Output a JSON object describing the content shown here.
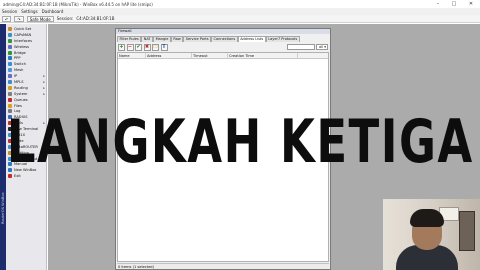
{
  "titlebar": {
    "title": "admin@C4:AD:34:B1:0F:1B (MikroTik) - WinBox v6.44.5 on hAP lite (smips)"
  },
  "menubar": {
    "items": [
      "Session",
      "Settings",
      "Dashboard"
    ]
  },
  "toolbar": {
    "safe_mode_label": "Safe Mode",
    "session_label": "Session:",
    "session_value": "C4:AD:34:B1:0F:1B"
  },
  "sidebar": {
    "vertical_label": "RouterOS WinBox",
    "items": [
      {
        "label": "Quick Set",
        "icon": "quickset-icon",
        "color": "#d08a2a",
        "submenu": false
      },
      {
        "label": "CAPsMAN",
        "icon": "capsman-icon",
        "color": "#3a8fd0",
        "submenu": false
      },
      {
        "label": "Interfaces",
        "icon": "interfaces-icon",
        "color": "#2a9a3a",
        "submenu": false
      },
      {
        "label": "Wireless",
        "icon": "wireless-icon",
        "color": "#6a6ac8",
        "submenu": false
      },
      {
        "label": "Bridge",
        "icon": "bridge-icon",
        "color": "#2a9a3a",
        "submenu": false
      },
      {
        "label": "PPP",
        "icon": "ppp-icon",
        "color": "#2a7ac0",
        "submenu": false
      },
      {
        "label": "Switch",
        "icon": "switch-icon",
        "color": "#3a8fd0",
        "submenu": false
      },
      {
        "label": "Mesh",
        "icon": "mesh-icon",
        "color": "#4a9ad8",
        "submenu": false
      },
      {
        "label": "IP",
        "icon": "ip-icon",
        "color": "#6a6ac8",
        "submenu": true
      },
      {
        "label": "MPLS",
        "icon": "mpls-icon",
        "color": "#3a8fd0",
        "submenu": true
      },
      {
        "label": "Routing",
        "icon": "routing-icon",
        "color": "#d0a02a",
        "submenu": true
      },
      {
        "label": "System",
        "icon": "system-icon",
        "color": "#808080",
        "submenu": true
      },
      {
        "label": "Queues",
        "icon": "queues-icon",
        "color": "#c0302a",
        "submenu": false
      },
      {
        "label": "Files",
        "icon": "files-icon",
        "color": "#d0a02a",
        "submenu": false
      },
      {
        "label": "Log",
        "icon": "log-icon",
        "color": "#7a7a7a",
        "submenu": false
      },
      {
        "label": "RADIUS",
        "icon": "radius-icon",
        "color": "#3a6ab0",
        "submenu": false
      },
      {
        "label": "Tools",
        "icon": "tools-icon",
        "color": "#c0302a",
        "submenu": true
      },
      {
        "label": "New Terminal",
        "icon": "terminal-icon",
        "color": "#222222",
        "submenu": false
      },
      {
        "label": "Dot1X",
        "icon": "dot1x-icon",
        "color": "#3a8fd0",
        "submenu": false
      },
      {
        "label": "Dude",
        "icon": "dude-icon",
        "color": "#c03030",
        "submenu": false
      },
      {
        "label": "MetaROUTER",
        "icon": "metarouter-icon",
        "color": "#3a8fd0",
        "submenu": false
      },
      {
        "label": "Partition",
        "icon": "partition-icon",
        "color": "#d08a2a",
        "submenu": false
      },
      {
        "label": "Make Supout.rif",
        "icon": "supout-icon",
        "color": "#3a8fd0",
        "submenu": false
      },
      {
        "label": "Manual",
        "icon": "manual-icon",
        "color": "#2a7ac0",
        "submenu": false
      },
      {
        "label": "New WinBox",
        "icon": "winbox-icon",
        "color": "#2a7ac0",
        "submenu": false
      },
      {
        "label": "Exit",
        "icon": "exit-icon",
        "color": "#c0302a",
        "submenu": false
      }
    ]
  },
  "dialog": {
    "title": "Firewall",
    "tabs": [
      "Filter Rules",
      "NAT",
      "Mangle",
      "Raw",
      "Service Ports",
      "Connections",
      "Address Lists",
      "Layer7 Protocols"
    ],
    "active_tab": "Address Lists",
    "buttons": [
      {
        "name": "add-icon",
        "glyph": "+",
        "color": "#1a7a1a"
      },
      {
        "name": "remove-icon",
        "glyph": "−",
        "color": "#c02020"
      },
      {
        "name": "enable-icon",
        "glyph": "✔",
        "color": "#1a7a1a"
      },
      {
        "name": "disable-icon",
        "glyph": "✖",
        "color": "#c02020"
      },
      {
        "name": "comment-icon",
        "glyph": "▭",
        "color": "#c8a81a"
      },
      {
        "name": "filter-icon",
        "glyph": "T",
        "color": "#2a5ab0"
      }
    ],
    "find_select_label": "all",
    "columns": [
      "Name",
      "Address",
      "Timeout",
      "Creation Time"
    ],
    "status": "0 items (1 selected)"
  },
  "overlay": {
    "text": "LANGKAH KETIGA"
  }
}
